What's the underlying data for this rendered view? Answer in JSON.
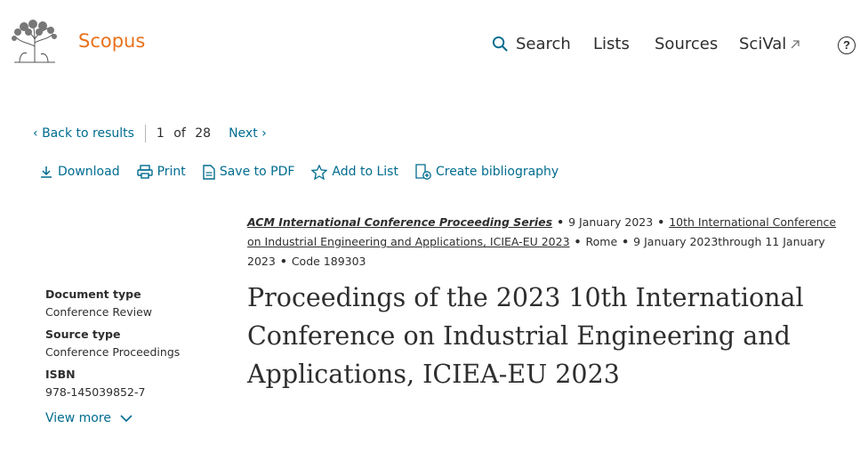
{
  "header": {
    "brand": "Scopus",
    "nav": [
      {
        "label": "Search"
      },
      {
        "label": "Lists"
      },
      {
        "label": "Sources"
      },
      {
        "label": "SciVal",
        "external": true
      }
    ],
    "help_label": "?"
  },
  "results_nav": {
    "back_label": "Back to results",
    "current": "1",
    "of_label": "of",
    "total": "28",
    "next_label": "Next"
  },
  "actions": [
    {
      "label": "Download",
      "icon": "download-icon"
    },
    {
      "label": "Print",
      "icon": "print-icon"
    },
    {
      "label": "Save to PDF",
      "icon": "pdf-icon"
    },
    {
      "label": "Add to List",
      "icon": "star-icon"
    },
    {
      "label": "Create bibliography",
      "icon": "bibliography-icon"
    }
  ],
  "source": {
    "series": "ACM International Conference Proceeding Series",
    "date": "9 January 2023",
    "conference": "10th International Conference on Industrial Engineering and Applications, ICIEA-EU 2023",
    "location": "Rome",
    "conf_dates": "9 January 2023through 11 January 2023",
    "code": "Code 189303"
  },
  "sidebar": {
    "document_type_label": "Document type",
    "document_type": "Conference Review",
    "source_type_label": "Source type",
    "source_type": "Conference Proceedings",
    "isbn_label": "ISBN",
    "isbn": "978-145039852-7",
    "view_more": "View more"
  },
  "document": {
    "title": "Proceedings of the 2023 10th International Conference on Industrial Engineering and Applications, ICIEA-EU 2023"
  },
  "colors": {
    "brand": "#e9711c",
    "link": "#006c8f",
    "text": "#2e2e2e"
  }
}
